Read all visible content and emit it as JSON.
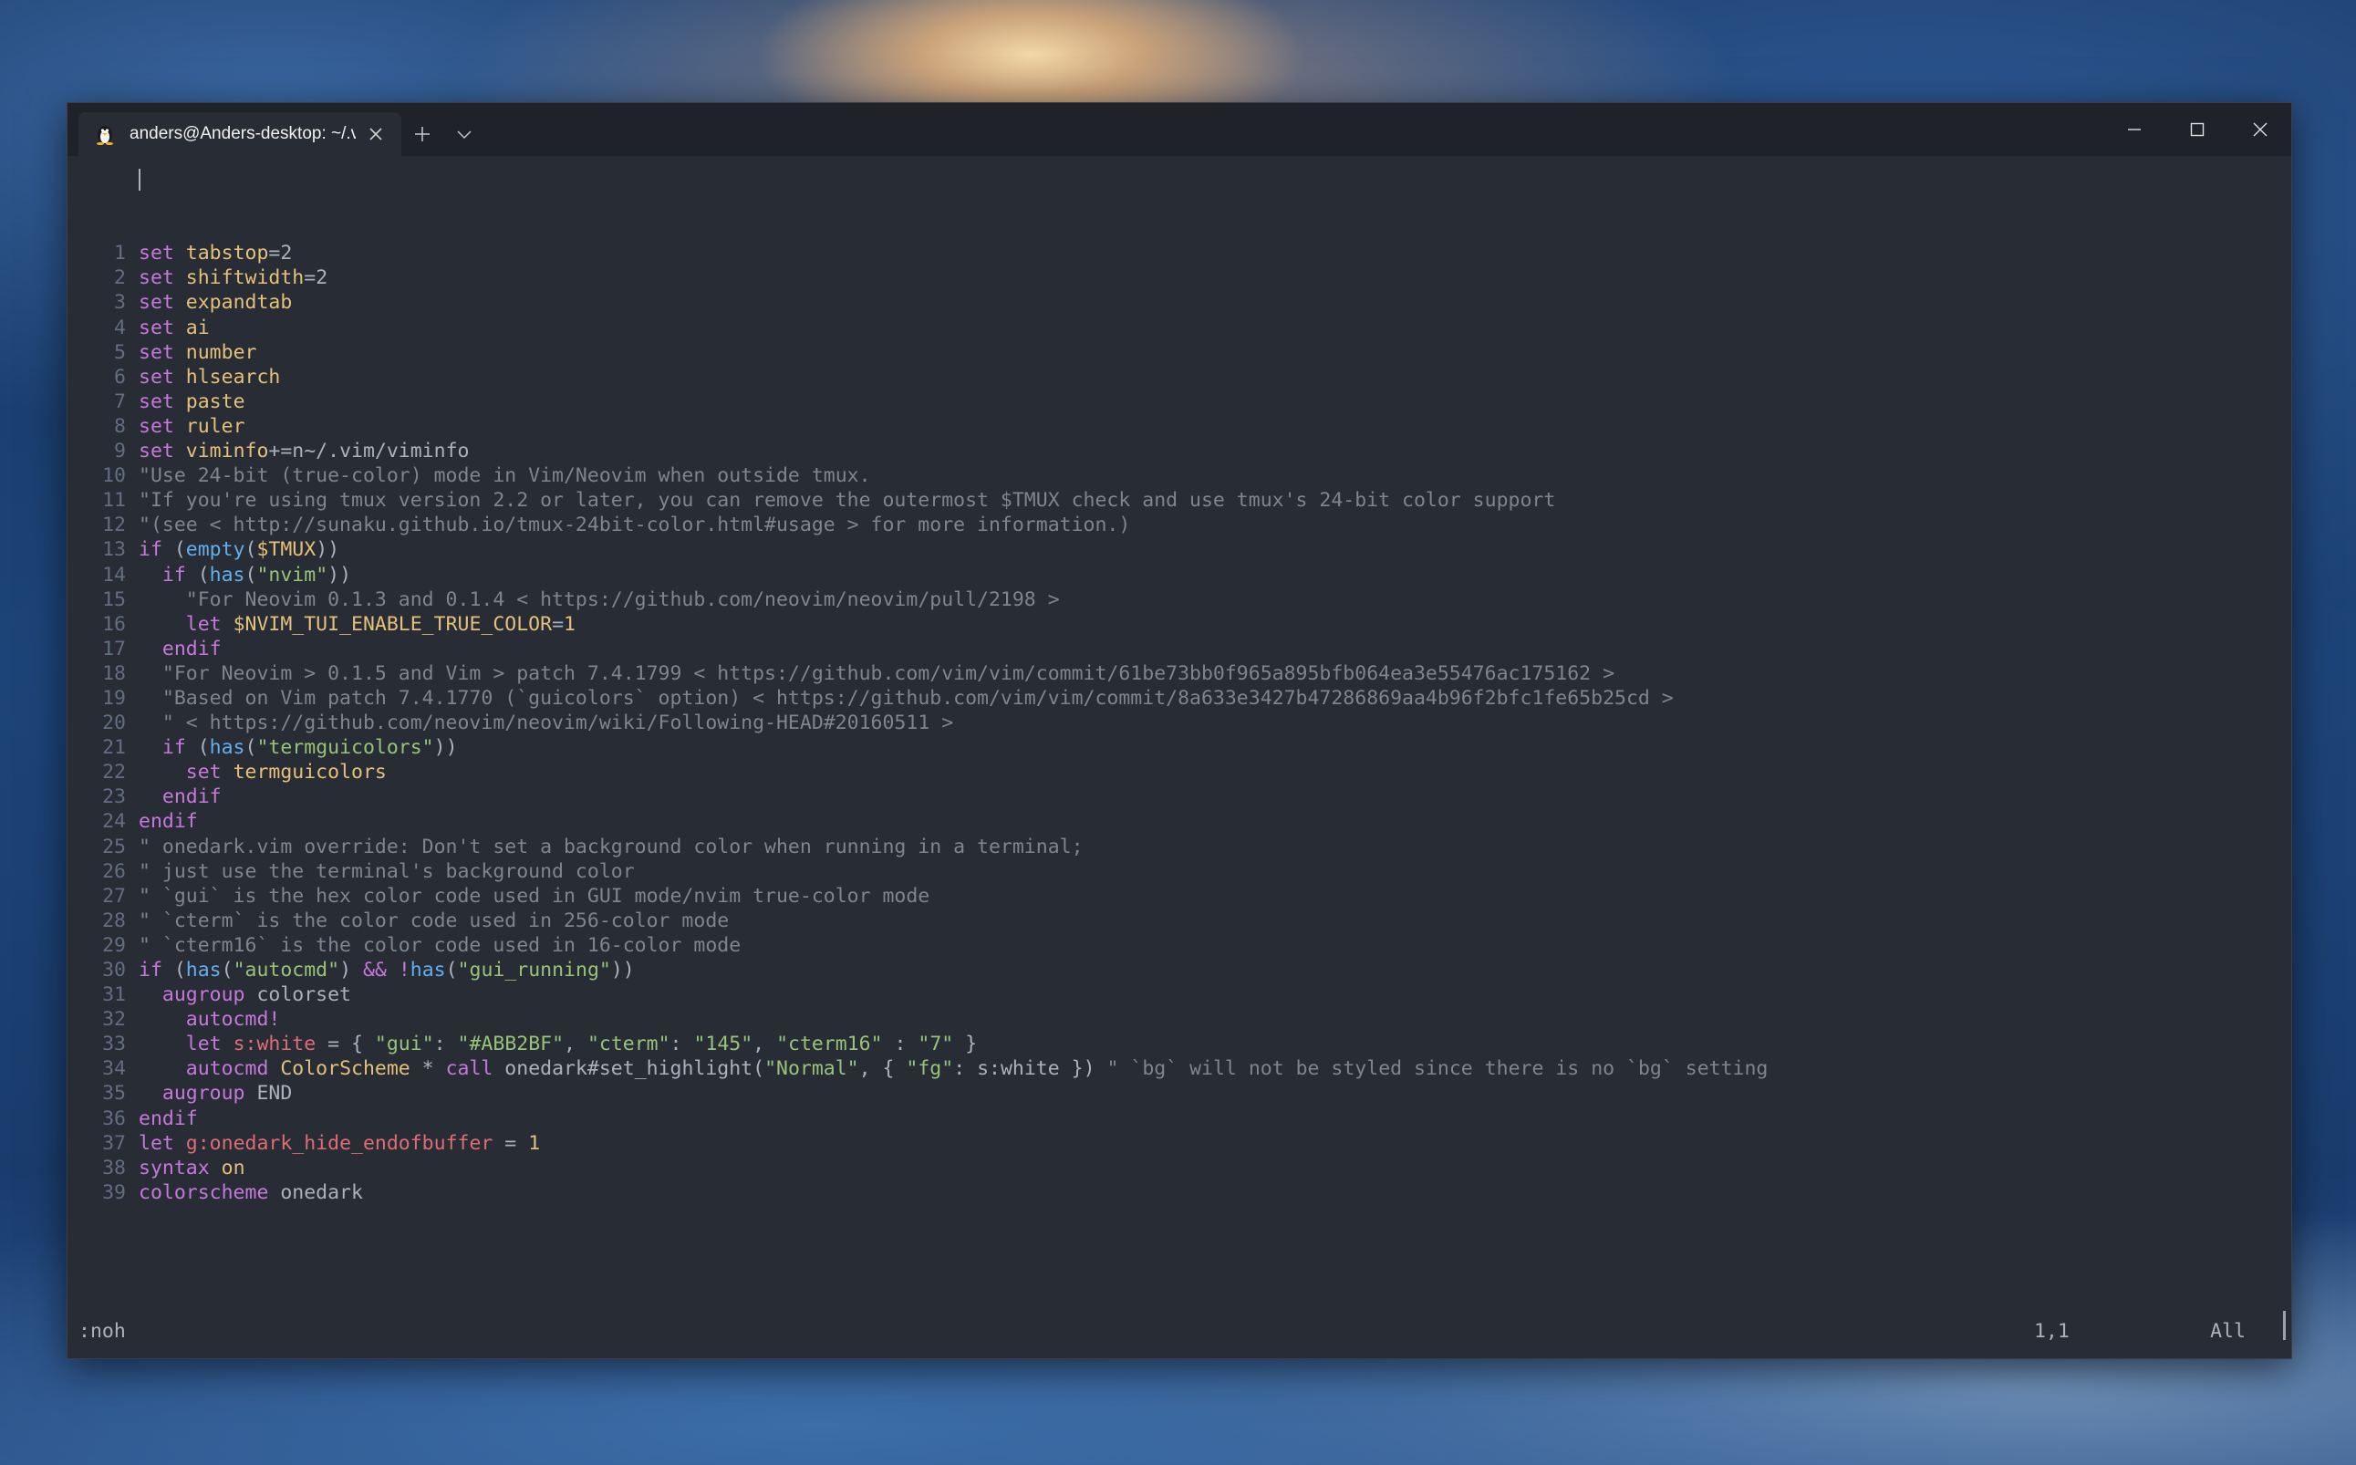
{
  "tab": {
    "title": "anders@Anders-desktop: ~/.vim",
    "icon": "linux-penguin-icon"
  },
  "titlebar": {
    "new_tab": "+",
    "dropdown": "chevron-down"
  },
  "window_controls": [
    "minimize",
    "maximize",
    "close"
  ],
  "editor": {
    "lines": [
      {
        "n": "1",
        "t": [
          [
            "k",
            "set"
          ],
          [
            "pl",
            " "
          ],
          [
            "v",
            "tabstop"
          ],
          [
            "pl",
            "=2"
          ]
        ]
      },
      {
        "n": "2",
        "t": [
          [
            "k",
            "set"
          ],
          [
            "pl",
            " "
          ],
          [
            "v",
            "shiftwidth"
          ],
          [
            "pl",
            "=2"
          ]
        ]
      },
      {
        "n": "3",
        "t": [
          [
            "k",
            "set"
          ],
          [
            "pl",
            " "
          ],
          [
            "v",
            "expandtab"
          ]
        ]
      },
      {
        "n": "4",
        "t": [
          [
            "k",
            "set"
          ],
          [
            "pl",
            " "
          ],
          [
            "v",
            "ai"
          ]
        ]
      },
      {
        "n": "5",
        "t": [
          [
            "k",
            "set"
          ],
          [
            "pl",
            " "
          ],
          [
            "v",
            "number"
          ]
        ]
      },
      {
        "n": "6",
        "t": [
          [
            "k",
            "set"
          ],
          [
            "pl",
            " "
          ],
          [
            "v",
            "hlsearch"
          ]
        ]
      },
      {
        "n": "7",
        "t": [
          [
            "k",
            "set"
          ],
          [
            "pl",
            " "
          ],
          [
            "v",
            "paste"
          ]
        ]
      },
      {
        "n": "8",
        "t": [
          [
            "k",
            "set"
          ],
          [
            "pl",
            " "
          ],
          [
            "v",
            "ruler"
          ]
        ]
      },
      {
        "n": "9",
        "t": [
          [
            "k",
            "set"
          ],
          [
            "pl",
            " "
          ],
          [
            "v",
            "viminfo"
          ],
          [
            "pl",
            "+=n~/.vim/viminfo"
          ]
        ]
      },
      {
        "n": "10",
        "t": [
          [
            "c",
            "\"Use 24-bit (true-color) mode in Vim/Neovim when outside tmux."
          ]
        ]
      },
      {
        "n": "11",
        "t": [
          [
            "c",
            "\"If you're using tmux version 2.2 or later, you can remove the outermost $TMUX check and use tmux's 24-bit color support"
          ]
        ]
      },
      {
        "n": "12",
        "t": [
          [
            "c",
            "\"(see < http://sunaku.github.io/tmux-24bit-color.html#usage > for more information.)"
          ]
        ]
      },
      {
        "n": "13",
        "t": [
          [
            "k",
            "if"
          ],
          [
            "pl",
            " ("
          ],
          [
            "f",
            "empty"
          ],
          [
            "pl",
            "("
          ],
          [
            "v",
            "$TMUX"
          ],
          [
            "pl",
            "))"
          ]
        ]
      },
      {
        "n": "14",
        "t": [
          [
            "pl",
            "  "
          ],
          [
            "k",
            "if"
          ],
          [
            "pl",
            " ("
          ],
          [
            "f",
            "has"
          ],
          [
            "pl",
            "("
          ],
          [
            "s",
            "\"nvim\""
          ],
          [
            "pl",
            "))"
          ]
        ]
      },
      {
        "n": "15",
        "t": [
          [
            "pl",
            "    "
          ],
          [
            "c",
            "\"For Neovim 0.1.3 and 0.1.4 < https://github.com/neovim/neovim/pull/2198 >"
          ]
        ]
      },
      {
        "n": "16",
        "t": [
          [
            "pl",
            "    "
          ],
          [
            "k",
            "let"
          ],
          [
            "pl",
            " "
          ],
          [
            "v",
            "$NVIM_TUI_ENABLE_TRUE_COLOR"
          ],
          [
            "pl",
            "="
          ],
          [
            "v",
            "1"
          ]
        ]
      },
      {
        "n": "17",
        "t": [
          [
            "pl",
            "  "
          ],
          [
            "k",
            "endif"
          ]
        ]
      },
      {
        "n": "18",
        "t": [
          [
            "pl",
            "  "
          ],
          [
            "c",
            "\"For Neovim > 0.1.5 and Vim > patch 7.4.1799 < https://github.com/vim/vim/commit/61be73bb0f965a895bfb064ea3e55476ac175162 >"
          ]
        ]
      },
      {
        "n": "19",
        "t": [
          [
            "pl",
            "  "
          ],
          [
            "c",
            "\"Based on Vim patch 7.4.1770 (`guicolors` option) < https://github.com/vim/vim/commit/8a633e3427b47286869aa4b96f2bfc1fe65b25cd >"
          ]
        ]
      },
      {
        "n": "20",
        "t": [
          [
            "pl",
            "  "
          ],
          [
            "c",
            "\" < https://github.com/neovim/neovim/wiki/Following-HEAD#20160511 >"
          ]
        ]
      },
      {
        "n": "21",
        "t": [
          [
            "pl",
            "  "
          ],
          [
            "k",
            "if"
          ],
          [
            "pl",
            " ("
          ],
          [
            "f",
            "has"
          ],
          [
            "pl",
            "("
          ],
          [
            "s",
            "\"termguicolors\""
          ],
          [
            "pl",
            "))"
          ]
        ]
      },
      {
        "n": "22",
        "t": [
          [
            "pl",
            "    "
          ],
          [
            "k",
            "set"
          ],
          [
            "pl",
            " "
          ],
          [
            "v",
            "termguicolors"
          ]
        ]
      },
      {
        "n": "23",
        "t": [
          [
            "pl",
            "  "
          ],
          [
            "k",
            "endif"
          ]
        ]
      },
      {
        "n": "24",
        "t": [
          [
            "k",
            "endif"
          ]
        ]
      },
      {
        "n": "25",
        "t": [
          [
            "c",
            "\" onedark.vim override: Don't set a background color when running in a terminal;"
          ]
        ]
      },
      {
        "n": "26",
        "t": [
          [
            "c",
            "\" just use the terminal's background color"
          ]
        ]
      },
      {
        "n": "27",
        "t": [
          [
            "c",
            "\" `gui` is the hex color code used in GUI mode/nvim true-color mode"
          ]
        ]
      },
      {
        "n": "28",
        "t": [
          [
            "c",
            "\" `cterm` is the color code used in 256-color mode"
          ]
        ]
      },
      {
        "n": "29",
        "t": [
          [
            "c",
            "\" `cterm16` is the color code used in 16-color mode"
          ]
        ]
      },
      {
        "n": "30",
        "t": [
          [
            "k",
            "if"
          ],
          [
            "pl",
            " ("
          ],
          [
            "f",
            "has"
          ],
          [
            "pl",
            "("
          ],
          [
            "s",
            "\"autocmd\""
          ],
          [
            "pl",
            ") "
          ],
          [
            "k",
            "&&"
          ],
          [
            "pl",
            " "
          ],
          [
            "k",
            "!"
          ],
          [
            "f",
            "has"
          ],
          [
            "pl",
            "("
          ],
          [
            "s",
            "\"gui_running\""
          ],
          [
            "pl",
            "))"
          ]
        ]
      },
      {
        "n": "31",
        "t": [
          [
            "pl",
            "  "
          ],
          [
            "k",
            "augroup"
          ],
          [
            "pl",
            " colorset"
          ]
        ]
      },
      {
        "n": "32",
        "t": [
          [
            "pl",
            "    "
          ],
          [
            "k",
            "autocmd!"
          ]
        ]
      },
      {
        "n": "33",
        "t": [
          [
            "pl",
            "    "
          ],
          [
            "k",
            "let"
          ],
          [
            "pl",
            " "
          ],
          [
            "r",
            "s:white"
          ],
          [
            "pl",
            " = { "
          ],
          [
            "s",
            "\"gui\""
          ],
          [
            "pl",
            ": "
          ],
          [
            "s",
            "\"#ABB2BF\""
          ],
          [
            "pl",
            ", "
          ],
          [
            "s",
            "\"cterm\""
          ],
          [
            "pl",
            ": "
          ],
          [
            "s",
            "\"145\""
          ],
          [
            "pl",
            ", "
          ],
          [
            "s",
            "\"cterm16\""
          ],
          [
            "pl",
            " : "
          ],
          [
            "s",
            "\"7\""
          ],
          [
            "pl",
            " }"
          ]
        ]
      },
      {
        "n": "34",
        "t": [
          [
            "pl",
            "    "
          ],
          [
            "k",
            "autocmd"
          ],
          [
            "pl",
            " "
          ],
          [
            "v",
            "ColorScheme"
          ],
          [
            "pl",
            " * "
          ],
          [
            "k",
            "call"
          ],
          [
            "pl",
            " onedark#set_highlight("
          ],
          [
            "s",
            "\"Normal\""
          ],
          [
            "pl",
            ", { "
          ],
          [
            "s",
            "\"fg\""
          ],
          [
            "pl",
            ": s:white }) "
          ],
          [
            "c",
            "\" `bg` will not be styled since there is no `bg` setting"
          ]
        ]
      },
      {
        "n": "35",
        "t": [
          [
            "pl",
            "  "
          ],
          [
            "k",
            "augroup"
          ],
          [
            "pl",
            " END"
          ]
        ]
      },
      {
        "n": "36",
        "t": [
          [
            "k",
            "endif"
          ]
        ]
      },
      {
        "n": "37",
        "t": [
          [
            "k",
            "let"
          ],
          [
            "pl",
            " "
          ],
          [
            "r",
            "g:onedark_hide_endofbuffer"
          ],
          [
            "pl",
            " = "
          ],
          [
            "v",
            "1"
          ]
        ]
      },
      {
        "n": "38",
        "t": [
          [
            "k",
            "syntax"
          ],
          [
            "pl",
            " "
          ],
          [
            "v",
            "on"
          ]
        ]
      },
      {
        "n": "39",
        "t": [
          [
            "k",
            "colorscheme"
          ],
          [
            "pl",
            " onedark"
          ]
        ]
      }
    ]
  },
  "status": {
    "command": ":noh",
    "position": "1,1",
    "scroll": "All"
  },
  "colors": {
    "background": "#282c34",
    "keyword": "#c678dd",
    "variable": "#e5c07b",
    "string": "#98c379",
    "comment": "#7f848e",
    "function": "#61afef",
    "scoped_var": "#e06c75",
    "line_number": "#636d83",
    "text": "#abb2bf"
  }
}
